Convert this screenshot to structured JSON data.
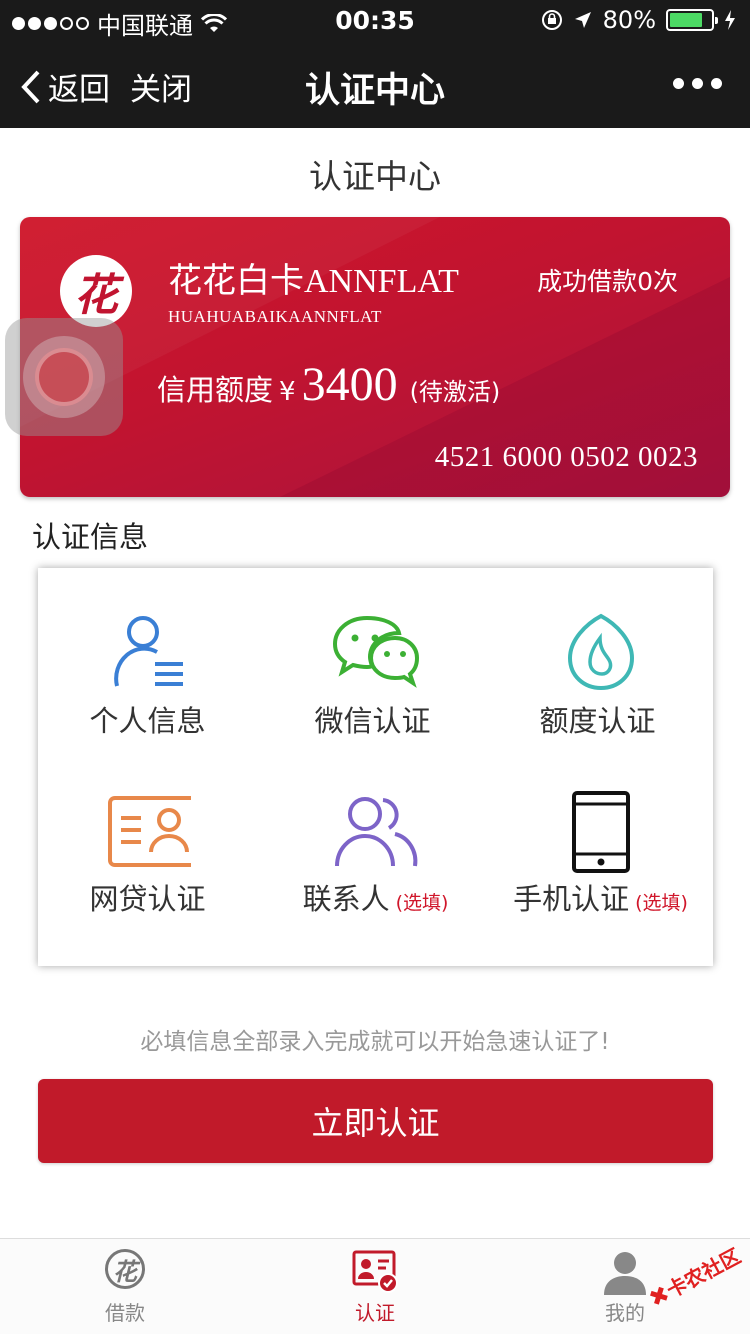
{
  "status_bar": {
    "carrier": "中国联通",
    "time": "00:35",
    "battery": "80%",
    "battery_level": 0.8
  },
  "nav": {
    "back_label": "返回",
    "close_label": "关闭",
    "title": "认证中心"
  },
  "page_title": "认证中心",
  "card": {
    "logo_char": "花",
    "name": "花花白卡ANNFLAT",
    "subtitle": "HUAHUABAIKAANNFLAT",
    "loan_count": "成功借款0次",
    "credit_label": "信用额度",
    "currency": "¥",
    "credit_amount": "3400",
    "credit_status": "(待激活)",
    "card_number": "4521 6000 0502 0023"
  },
  "section_label": "认证信息",
  "grid": {
    "items": [
      {
        "label": "个人信息",
        "optional": ""
      },
      {
        "label": "微信认证",
        "optional": ""
      },
      {
        "label": "额度认证",
        "optional": ""
      },
      {
        "label": "网贷认证",
        "optional": ""
      },
      {
        "label": "联系人",
        "optional": "(选填)"
      },
      {
        "label": "手机认证",
        "optional": "(选填)"
      }
    ]
  },
  "hint": "必填信息全部录入完成就可以开始急速认证了!",
  "cta_label": "立即认证",
  "tabbar": {
    "tabs": [
      {
        "label": "借款",
        "icon_char": "花"
      },
      {
        "label": "认证"
      },
      {
        "label": "我的"
      }
    ],
    "active": "认证"
  },
  "watermark": "卡农社区",
  "colors": {
    "brand_red": "#c11a2a",
    "wechat_green": "#3cb034",
    "blue": "#3a7fd5",
    "teal": "#3fb8b5",
    "orange": "#e8884a",
    "purple": "#7d64c8"
  }
}
